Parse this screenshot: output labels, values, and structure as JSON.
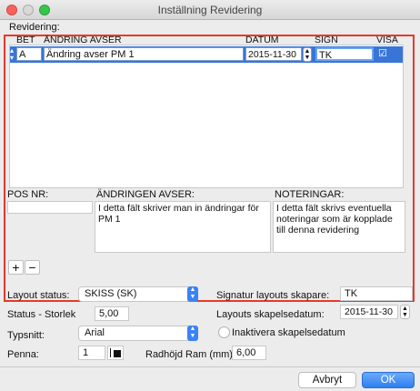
{
  "window": {
    "title": "Inställning Revidering"
  },
  "revision_section": {
    "label": "Revidering:"
  },
  "table": {
    "headers": {
      "bet": "BET",
      "andring": "ÄNDRING AVSER",
      "datum": "DATUM",
      "sign": "SIGN",
      "visa": "VISA"
    },
    "row": {
      "bet": "A",
      "andring": "Ändring avser PM 1",
      "datum": "2015-11-30",
      "sign": "TK",
      "visa_checked": true
    }
  },
  "details": {
    "pos_label": "POS NR:",
    "andring_label": "ÄNDRINGEN AVSER:",
    "andring_text": "I detta fält skriver man in ändringar för PM 1",
    "noteringar_label": "NOTERINGAR:",
    "noteringar_text": "I detta fält skrivs eventuella noteringar som är kopplade till denna revidering"
  },
  "buttons": {
    "add": "+",
    "remove": "−",
    "cancel": "Avbryt",
    "ok": "OK"
  },
  "settings": {
    "layout_status_label": "Layout status:",
    "layout_status_value": "SKISS (SK)",
    "status_size_label": "Status - Storlek",
    "status_size_value": "5,00",
    "typsnitt_label": "Typsnitt:",
    "typsnitt_value": "Arial",
    "penna_label": "Penna:",
    "penna_value": "1",
    "radhojd_label": "Radhöjd Ram (mm):",
    "radhojd_value": "6,00",
    "signatur_label": "Signatur layouts skapare:",
    "signatur_value": "TK",
    "skapelsedatum_label": "Layouts skapelsedatum:",
    "skapelsedatum_value": "2015-11-30",
    "inaktivera_label": "Inaktivera skapelsedatum",
    "inaktivera_checked": false
  },
  "colors": {
    "accent": "#3875d7",
    "highlight": "#e8392b"
  }
}
